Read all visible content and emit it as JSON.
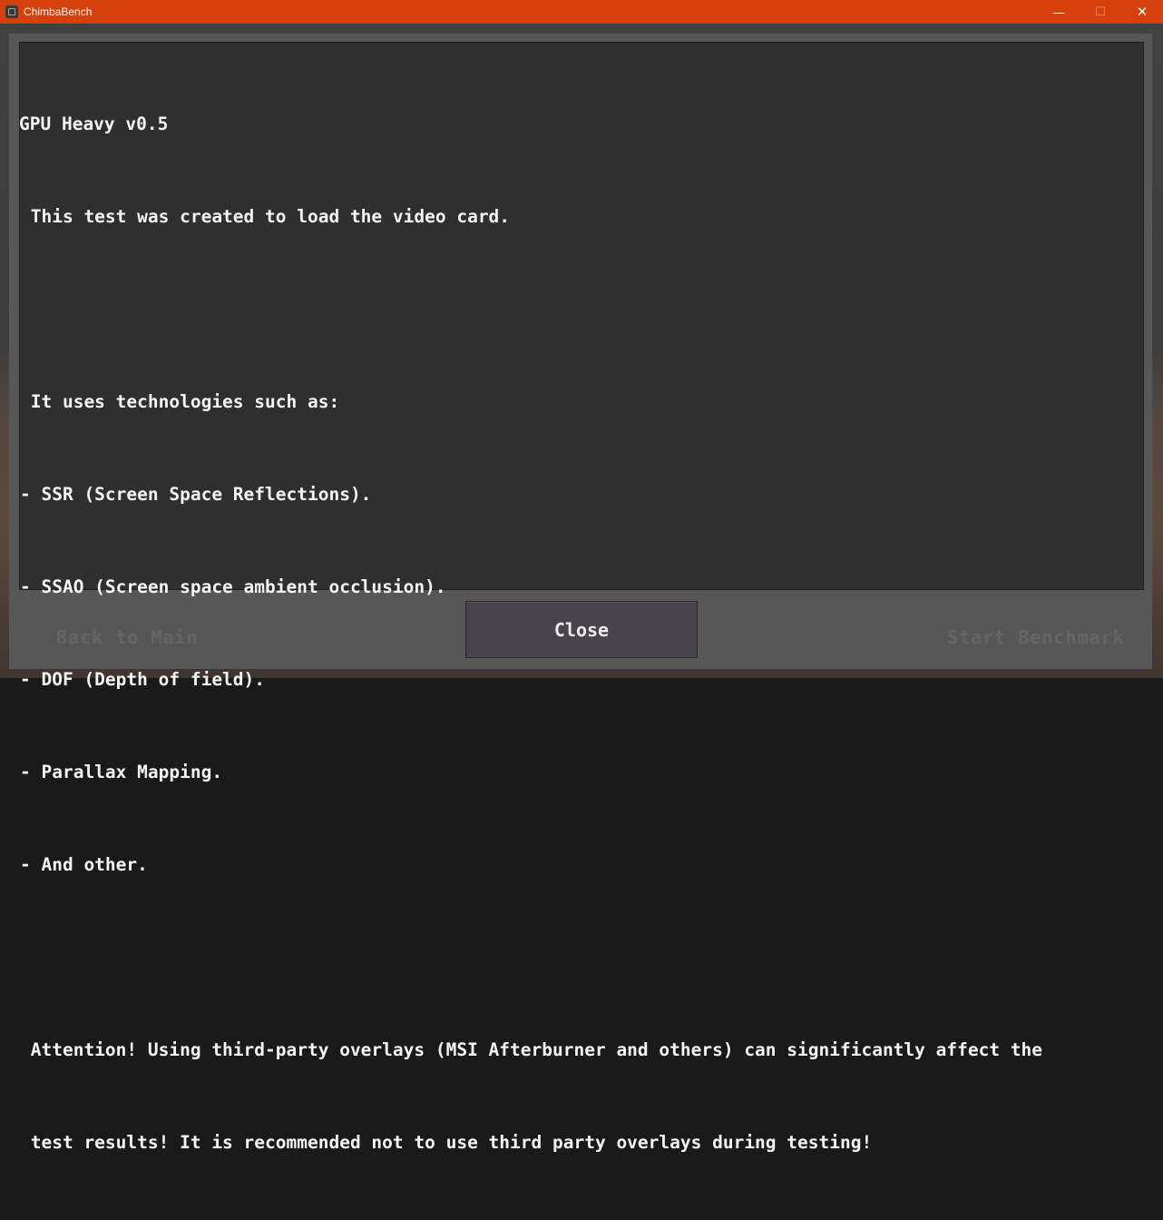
{
  "window": {
    "title": "ChimbaBench",
    "minimize_glyph": "—",
    "maximize_glyph": "☐",
    "close_glyph": "✕"
  },
  "background": {
    "back_label": "Back to Main",
    "start_label": "Start Benchmark"
  },
  "dialog": {
    "lines": [
      "GPU Heavy v0.5",
      " This test was created to load the video card.",
      "",
      " It uses technologies such as:",
      "- SSR (Screen Space Reflections).",
      "- SSAO (Screen space ambient occlusion).",
      "- DOF (Depth of field).",
      "- Parallax Mapping.",
      "- And other.",
      "",
      " Attention! Using third-party overlays (MSI Afterburner and others) can significantly affect the",
      " test results! It is recommended not to use third party overlays during testing!"
    ],
    "close_label": "Close"
  }
}
